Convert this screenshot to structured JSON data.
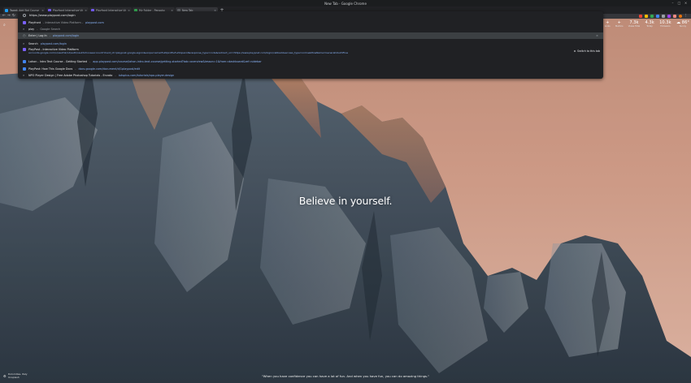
{
  "window": {
    "title": "New Tab - Google Chrome"
  },
  "tabs": [
    {
      "label": "Tweet: Add Bot Course - Scrim",
      "favicon_color": "#1d9bf0",
      "active": false
    },
    {
      "label": "Playfront Interactive Video Editor",
      "favicon_color": "#7b61ff",
      "active": false
    },
    {
      "label": "Playfront Interactive Video",
      "favicon_color": "#7b61ff",
      "active": false
    },
    {
      "label": "My Folder - Panopto",
      "favicon_color": "#34a853",
      "active": false
    },
    {
      "label": "New Tab",
      "favicon_color": "#5f6368",
      "active": true
    }
  ],
  "omnibox": {
    "input_value": "https://www.playpost.com/login",
    "suggestions": [
      {
        "title": "Playfront",
        "sep": "- Interactive Video Platform -",
        "url": "playpost.com",
        "icon_color": "#7b61ff"
      },
      {
        "title": "play",
        "sep": "-",
        "url": "Google Search",
        "icon_color": "#9aa0a6"
      },
      {
        "title": "Enter | Log In",
        "sep": "-",
        "url": "playpost.com/login",
        "icon_color": "#9aa0a6",
        "selected": true
      },
      {
        "title": "Search",
        "sep": "",
        "url": "playpost.com/login",
        "icon_color": "#9aa0a6"
      },
      {
        "title": "PlayPost - Interactive Video Platform",
        "sep": "-",
        "url": "accounts.google.com/o/oauth2/v2/auth/oauthchooseaccount?client_id=playpost-google-signin&scope=email%20profile%20openid&response_type=code&redirect_uri=https://www.playpost.com/login/callback&access_type=online&flowName=GeneralOAuthFlow",
        "icon_color": "#7b61ff",
        "switch": "Switch to this tab"
      },
      {
        "title": "Lahon - Intro Text Course - Getting Started",
        "sep": "-",
        "url": "app.playpost.com/course/lahon-intro-text-course/getting-started?tab=overview&lesson=1&from=dashboard&ref=sidebar",
        "icon_color": "#4285f4"
      },
      {
        "title": "PlayPost: How This Google Docs",
        "sep": "-",
        "url": "docs.google.com/document/d/1playpost/edit",
        "icon_color": "#4285f4"
      },
      {
        "title": "NPO Player Design | Free Adobe Photoshop Tutorials - Envato",
        "sep": "-",
        "url": "tutsplus.com/tutorials/npo-player-design",
        "icon_color": "#9aa0a6"
      }
    ]
  },
  "widgets": [
    {
      "value": "+",
      "label": "Links"
    },
    {
      "value": "+",
      "label": "Metrics"
    },
    {
      "value": "7.3k",
      "label": "Views Total"
    },
    {
      "value": "4.3k",
      "label": "Today"
    },
    {
      "value": "10.3k",
      "label": "Followers"
    },
    {
      "value": "☁ 86°",
      "label": "Sunny"
    }
  ],
  "focus_text": "Believe in yourself.",
  "quote": "\"When you have confidence you can have a lot of fun. And when you have fun, you can do amazing things.\"",
  "credit": {
    "line1": "Dolomites, Italy",
    "line2": "Unsplash"
  }
}
